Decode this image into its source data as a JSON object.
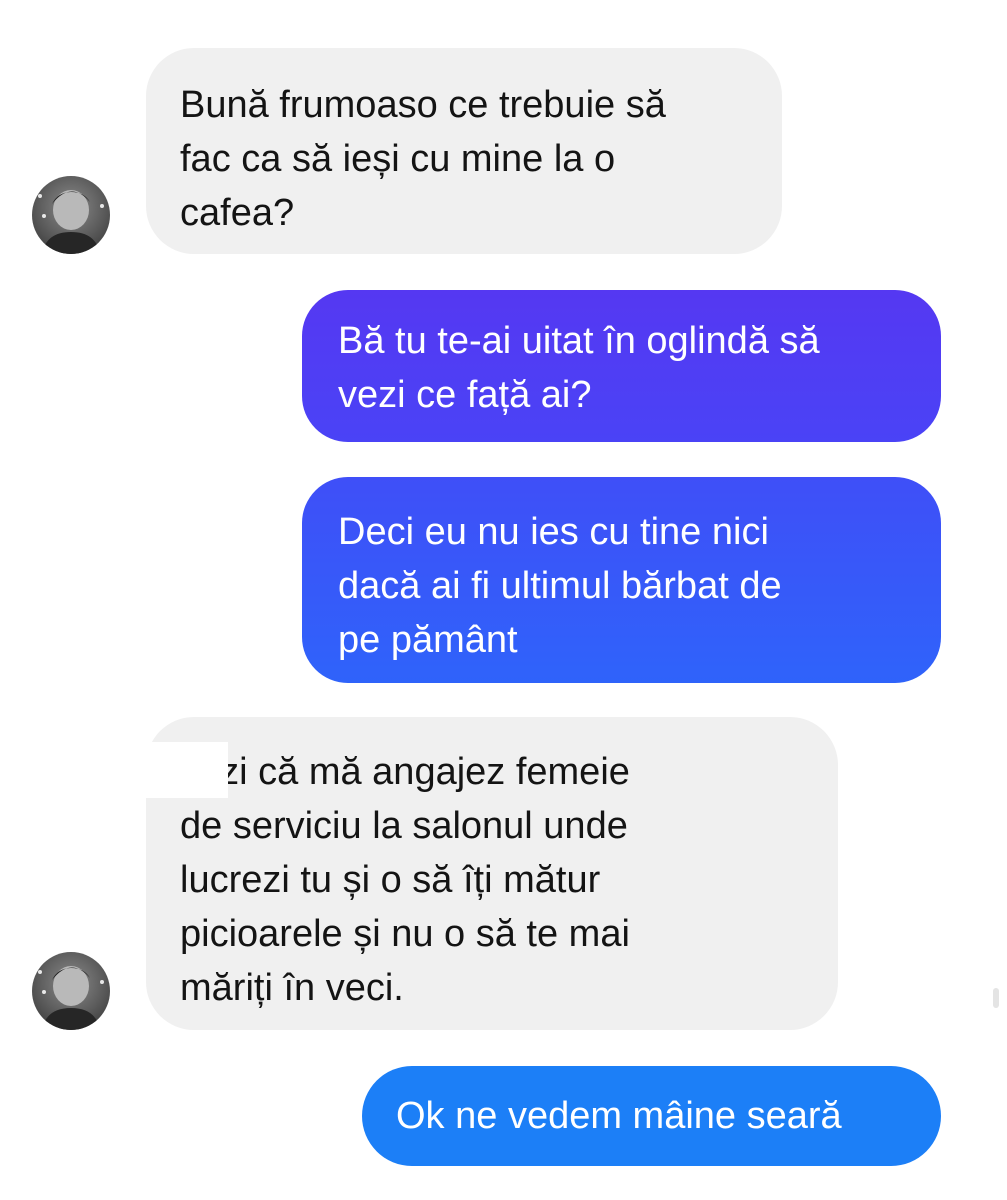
{
  "conversation": {
    "messages": [
      {
        "direction": "incoming",
        "text": "Bună frumoaso ce trebuie să\nfac ca să ieși cu mine la o\ncafea?"
      },
      {
        "direction": "outgoing",
        "text": "Bă tu te-ai uitat în oglindă să\nvezi ce față ai?"
      },
      {
        "direction": "outgoing",
        "text": "Deci eu nu ies cu tine nici\ndacă ai fi ultimul bărbat de\npe pământ"
      },
      {
        "direction": "incoming",
        "text": "vezi că mă angajez femeie\nde serviciu la salonul unde\nlucrezi tu și o să îți mătur\npicioarele și nu o să te mai\nmăriți în veci."
      },
      {
        "direction": "outgoing",
        "text": "Ok ne vedem mâine seară"
      }
    ]
  },
  "colors": {
    "incoming_bubble": "#f0f0f0",
    "outgoing_top": "#5538f2",
    "outgoing_middle": "#3f4ff8",
    "outgoing_bottom": "#1c7ff7"
  },
  "icons": {
    "contact_avatar": "avatar-photo-icon"
  }
}
